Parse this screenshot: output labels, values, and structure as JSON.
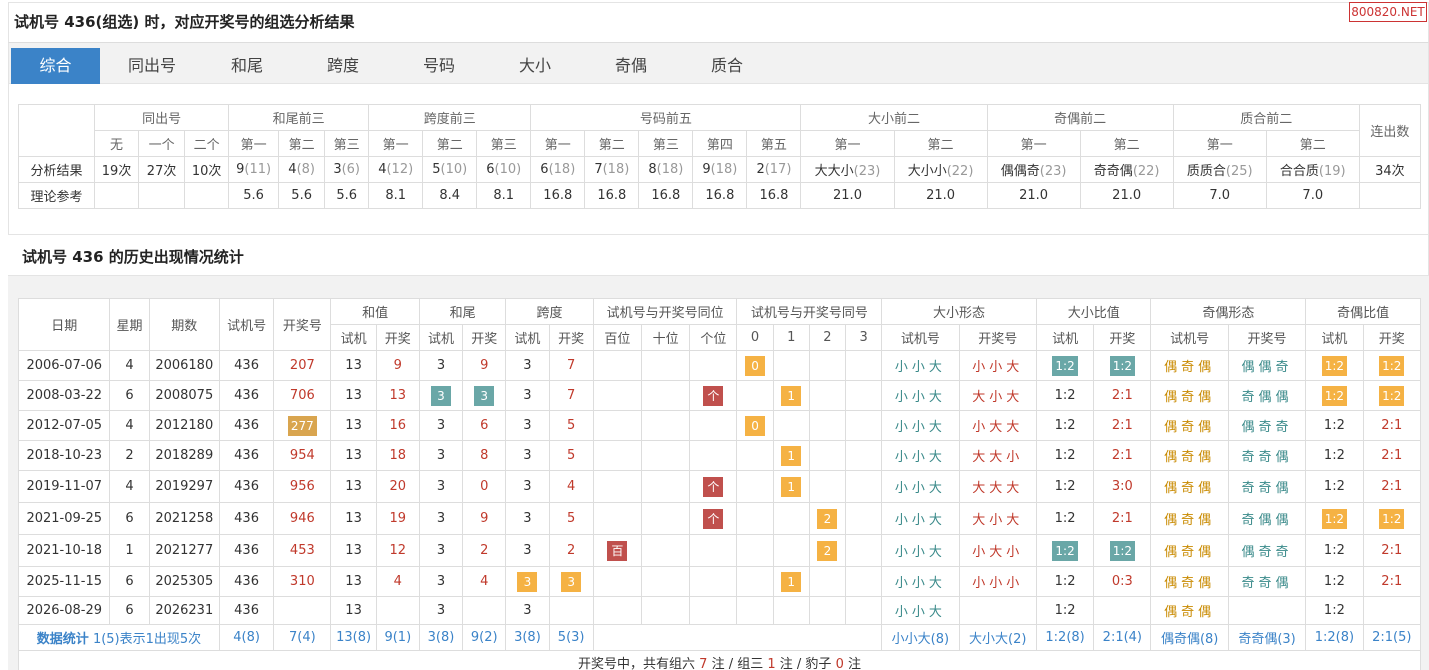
{
  "title": "试机号 436(组选) 时，对应开奖号的组选分析结果",
  "site_badge": "800820.NET",
  "tabs": [
    "综合",
    "同出号",
    "和尾",
    "跨度",
    "号码",
    "大小",
    "奇偶",
    "质合"
  ],
  "analysis": {
    "groups": [
      "同出号",
      "和尾前三",
      "跨度前三",
      "号码前五",
      "大小前二",
      "奇偶前二",
      "质合前二",
      "连出数"
    ],
    "sub_headers": [
      "无",
      "一个",
      "二个",
      "第一",
      "第二",
      "第三",
      "第一",
      "第二",
      "第三",
      "第一",
      "第二",
      "第三",
      "第四",
      "第五",
      "第一",
      "第二",
      "第一",
      "第二",
      "第一",
      "第二"
    ],
    "result_label": "分析结果",
    "result": [
      {
        "v": "19次",
        "g": ""
      },
      {
        "v": "27次",
        "g": ""
      },
      {
        "v": "10次",
        "g": ""
      },
      {
        "v": "9",
        "g": "(11)"
      },
      {
        "v": "4",
        "g": "(8)"
      },
      {
        "v": "3",
        "g": "(6)"
      },
      {
        "v": "4",
        "g": "(12)"
      },
      {
        "v": "5",
        "g": "(10)"
      },
      {
        "v": "6",
        "g": "(10)"
      },
      {
        "v": "6",
        "g": "(18)"
      },
      {
        "v": "7",
        "g": "(18)"
      },
      {
        "v": "8",
        "g": "(18)"
      },
      {
        "v": "9",
        "g": "(18)"
      },
      {
        "v": "2",
        "g": "(17)"
      },
      {
        "v": "大大小",
        "g": "(23)"
      },
      {
        "v": "大小小",
        "g": "(22)"
      },
      {
        "v": "偶偶奇",
        "g": "(23)"
      },
      {
        "v": "奇奇偶",
        "g": "(22)"
      },
      {
        "v": "质质合",
        "g": "(25)"
      },
      {
        "v": "合合质",
        "g": "(19)"
      },
      {
        "v": "34次",
        "g": ""
      }
    ],
    "ref_label": "理论参考",
    "ref": [
      "",
      "",
      "",
      "5.6",
      "5.6",
      "5.6",
      "8.1",
      "8.4",
      "8.1",
      "16.8",
      "16.8",
      "16.8",
      "16.8",
      "16.8",
      "21.0",
      "21.0",
      "21.0",
      "21.0",
      "7.0",
      "7.0",
      ""
    ]
  },
  "history_title": "试机号 436 的历史出现情况统计",
  "history": {
    "headers": {
      "date": "日期",
      "weekday": "星期",
      "period": "期数",
      "test": "试机号",
      "draw": "开奖号",
      "sum": "和值",
      "tail": "和尾",
      "span": "跨度",
      "pos": "试机号与开奖号同位",
      "same": "试机号与开奖号同号",
      "bs_form": "大小形态",
      "bs_ratio": "大小比值",
      "oe_form": "奇偶形态",
      "oe_ratio": "奇偶比值",
      "test_s": "试机",
      "draw_s": "开奖",
      "pos_sub": [
        "百位",
        "十位",
        "个位"
      ],
      "same_sub": [
        "0",
        "1",
        "2",
        "3"
      ],
      "test_num": "试机号",
      "draw_num": "开奖号"
    },
    "rows": [
      {
        "date": "2006-07-06",
        "wd": "4",
        "period": "2006180",
        "test": "436",
        "draw": "207",
        "sum_t": "13",
        "sum_d": "9",
        "tail_t": "3",
        "tail_d": "9",
        "span_t": "3",
        "span_d": "7",
        "same": "0",
        "bs_t": "小小大",
        "bs_d": "小小大",
        "bsr_t": "1:2",
        "bsr_d": "1:2",
        "oe_t": "偶奇偶",
        "oe_d": "偶偶奇",
        "oer_t": "1:2",
        "oer_d": "1:2"
      },
      {
        "date": "2008-03-22",
        "wd": "6",
        "period": "2008075",
        "test": "436",
        "draw": "706",
        "sum_t": "13",
        "sum_d": "13",
        "tail_t": "3",
        "tail_d": "3",
        "span_t": "3",
        "span_d": "7",
        "pos": "个",
        "same": "1",
        "bs_t": "小小大",
        "bs_d": "大小大",
        "bsr_t": "1:2",
        "bsr_d": "2:1",
        "oe_t": "偶奇偶",
        "oe_d": "奇偶偶",
        "oer_t": "1:2",
        "oer_d": "1:2"
      },
      {
        "date": "2012-07-05",
        "wd": "4",
        "period": "2012180",
        "test": "436",
        "draw": "277",
        "sum_t": "13",
        "sum_d": "16",
        "tail_t": "3",
        "tail_d": "6",
        "span_t": "3",
        "span_d": "5",
        "same": "0",
        "bs_t": "小小大",
        "bs_d": "小大大",
        "bsr_t": "1:2",
        "bsr_d": "2:1",
        "oe_t": "偶奇偶",
        "oe_d": "偶奇奇",
        "oer_t": "1:2",
        "oer_d": "2:1"
      },
      {
        "date": "2018-10-23",
        "wd": "2",
        "period": "2018289",
        "test": "436",
        "draw": "954",
        "sum_t": "13",
        "sum_d": "18",
        "tail_t": "3",
        "tail_d": "8",
        "span_t": "3",
        "span_d": "5",
        "same": "1",
        "bs_t": "小小大",
        "bs_d": "大大小",
        "bsr_t": "1:2",
        "bsr_d": "2:1",
        "oe_t": "偶奇偶",
        "oe_d": "奇奇偶",
        "oer_t": "1:2",
        "oer_d": "2:1"
      },
      {
        "date": "2019-11-07",
        "wd": "4",
        "period": "2019297",
        "test": "436",
        "draw": "956",
        "sum_t": "13",
        "sum_d": "20",
        "tail_t": "3",
        "tail_d": "0",
        "span_t": "3",
        "span_d": "4",
        "pos": "个",
        "same": "1",
        "bs_t": "小小大",
        "bs_d": "大大大",
        "bsr_t": "1:2",
        "bsr_d": "3:0",
        "oe_t": "偶奇偶",
        "oe_d": "奇奇偶",
        "oer_t": "1:2",
        "oer_d": "2:1"
      },
      {
        "date": "2021-09-25",
        "wd": "6",
        "period": "2021258",
        "test": "436",
        "draw": "946",
        "sum_t": "13",
        "sum_d": "19",
        "tail_t": "3",
        "tail_d": "9",
        "span_t": "3",
        "span_d": "5",
        "pos": "个",
        "same": "2",
        "bs_t": "小小大",
        "bs_d": "大小大",
        "bsr_t": "1:2",
        "bsr_d": "2:1",
        "oe_t": "偶奇偶",
        "oe_d": "奇偶偶",
        "oer_t": "1:2",
        "oer_d": "1:2"
      },
      {
        "date": "2021-10-18",
        "wd": "1",
        "period": "2021277",
        "test": "436",
        "draw": "453",
        "sum_t": "13",
        "sum_d": "12",
        "tail_t": "3",
        "tail_d": "2",
        "span_t": "3",
        "span_d": "2",
        "pos": "百",
        "same": "2",
        "bs_t": "小小大",
        "bs_d": "小大小",
        "bsr_t": "1:2",
        "bsr_d": "1:2",
        "oe_t": "偶奇偶",
        "oe_d": "偶奇奇",
        "oer_t": "1:2",
        "oer_d": "2:1"
      },
      {
        "date": "2025-11-15",
        "wd": "6",
        "period": "2025305",
        "test": "436",
        "draw": "310",
        "sum_t": "13",
        "sum_d": "4",
        "tail_t": "3",
        "tail_d": "4",
        "span_t": "3",
        "span_d": "3",
        "same": "1",
        "bs_t": "小小大",
        "bs_d": "小小小",
        "bsr_t": "1:2",
        "bsr_d": "0:3",
        "oe_t": "偶奇偶",
        "oe_d": "奇奇偶",
        "oer_t": "1:2",
        "oer_d": "2:1"
      },
      {
        "date": "2026-08-29",
        "wd": "6",
        "period": "2026231",
        "test": "436",
        "draw": "",
        "sum_t": "13",
        "sum_d": "",
        "tail_t": "3",
        "tail_d": "",
        "span_t": "3",
        "span_d": "",
        "bs_t": "小小大",
        "bs_d": "",
        "bsr_t": "1:2",
        "bsr_d": "",
        "oe_t": "偶奇偶",
        "oe_d": "",
        "oer_t": "1:2",
        "oer_d": ""
      }
    ],
    "stats": {
      "label": "数据统计",
      "note": "1(5)表示1出现5次",
      "test": "4(8)",
      "draw": "7(4)",
      "sum_t": "13(8)",
      "sum_d": "9(1)",
      "tail_t": "3(8)",
      "tail_d": "9(2)",
      "span_t": "3(8)",
      "span_d": "5(3)",
      "bs_t": "小小大(8)",
      "bs_d": "大小大(2)",
      "bsr_t": "1:2(8)",
      "bsr_d": "2:1(4)",
      "oe_t": "偶奇偶(8)",
      "oe_d": "奇奇偶(3)",
      "oer_t": "1:2(8)",
      "oer_d": "2:1(5)"
    },
    "summary": {
      "a": "开奖号中，共有组六",
      "n1": "7",
      "b": "注 / 组三",
      "n2": "1",
      "c": "注 / 豹子",
      "n3": "0",
      "d": "注"
    }
  },
  "colors": {
    "accent": "#3b83c8",
    "chip_orange": "#f5b244",
    "chip_teal": "#6aa7a7",
    "chip_maroon": "#c0504d",
    "red": "#c0392b"
  }
}
